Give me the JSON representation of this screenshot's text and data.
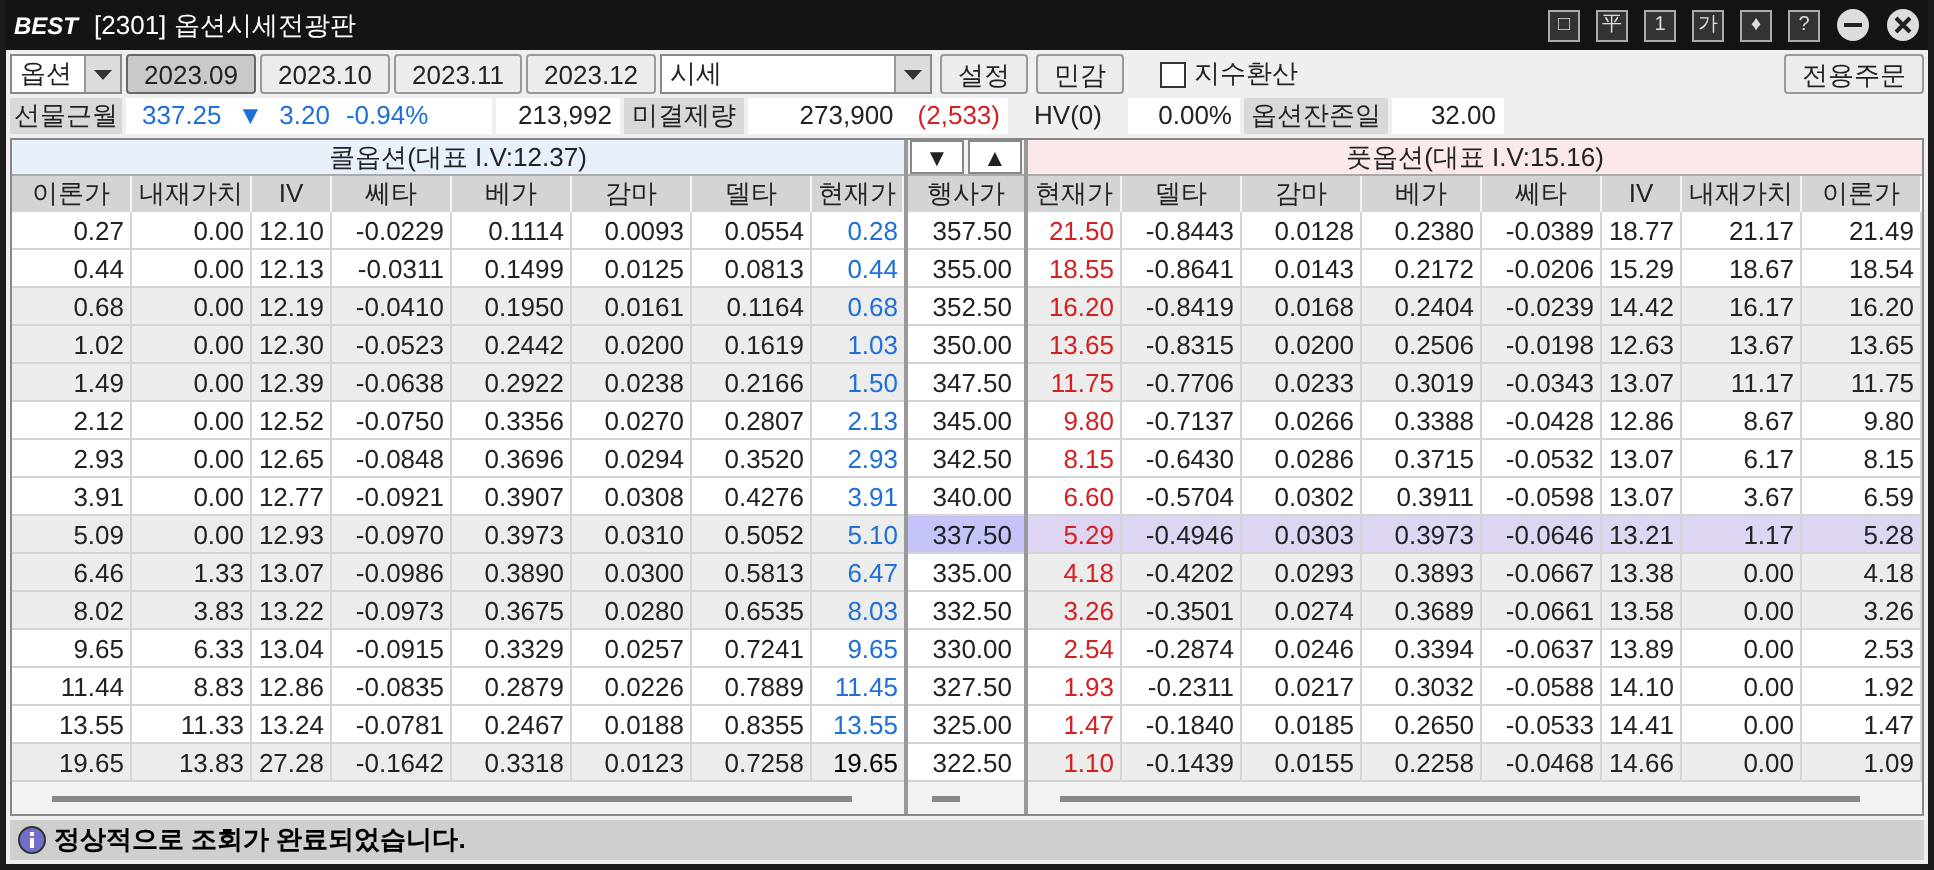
{
  "window": {
    "logo": "BEST",
    "title": "[2301] 옵션시세전광판",
    "tool_buttons": [
      "□",
      "平",
      "1",
      "가",
      "♦",
      "?"
    ]
  },
  "toolbar": {
    "product": "옵션",
    "months": [
      {
        "label": "2023.09",
        "selected": true
      },
      {
        "label": "2023.10",
        "selected": false
      },
      {
        "label": "2023.11",
        "selected": false
      },
      {
        "label": "2023.12",
        "selected": false
      }
    ],
    "view": "시세",
    "buttons": [
      "설정",
      "민감"
    ],
    "index_convert": {
      "label": "지수환산",
      "checked": false
    },
    "order_button": "전용주문"
  },
  "info": {
    "futures_label": "선물근월",
    "futures_price": "337.25",
    "futures_arrow": "▼",
    "futures_change": "3.20",
    "futures_rate": "-0.94%",
    "futures_volume": "213,992",
    "oi_label": "미결제량",
    "oi_value": "273,900",
    "oi_change": "(2,533)",
    "hv_label": "HV(0)",
    "hv_value": "0.00%",
    "days_label": "옵션잔존일",
    "days_value": "32.00"
  },
  "call_title": "콜옵션(대표 I.V:12.37)",
  "put_title": "풋옵션(대표 I.V:15.16)",
  "sort_buttons": [
    "▼",
    "▲"
  ],
  "call_columns": [
    "이론가",
    "내재가치",
    "IV",
    "쎄타",
    "베가",
    "감마",
    "델타",
    "현재가"
  ],
  "strike_column": "행사가",
  "put_columns": [
    "현재가",
    "델타",
    "감마",
    "베가",
    "쎄타",
    "IV",
    "내재가치",
    "이론가"
  ],
  "rows": [
    {
      "strike": "357.50",
      "shaded": false,
      "selected": false,
      "call": [
        "0.27",
        "0.00",
        "12.10",
        "-0.0229",
        "0.1114",
        "0.0093",
        "0.0554"
      ],
      "call_price": {
        "value": "0.28",
        "color": "#1e6fd9"
      },
      "put_price": {
        "value": "21.50",
        "color": "#d42020"
      },
      "put": [
        "-0.8443",
        "0.0128",
        "0.2380",
        "-0.0389",
        "18.77",
        "21.17",
        "21.49"
      ]
    },
    {
      "strike": "355.00",
      "shaded": false,
      "selected": false,
      "call": [
        "0.44",
        "0.00",
        "12.13",
        "-0.0311",
        "0.1499",
        "0.0125",
        "0.0813"
      ],
      "call_price": {
        "value": "0.44",
        "color": "#1e6fd9"
      },
      "put_price": {
        "value": "18.55",
        "color": "#d42020"
      },
      "put": [
        "-0.8641",
        "0.0143",
        "0.2172",
        "-0.0206",
        "15.29",
        "18.67",
        "18.54"
      ]
    },
    {
      "strike": "352.50",
      "shaded": true,
      "selected": false,
      "call": [
        "0.68",
        "0.00",
        "12.19",
        "-0.0410",
        "0.1950",
        "0.0161",
        "0.1164"
      ],
      "call_price": {
        "value": "0.68",
        "color": "#1e6fd9"
      },
      "put_price": {
        "value": "16.20",
        "color": "#d42020"
      },
      "put": [
        "-0.8419",
        "0.0168",
        "0.2404",
        "-0.0239",
        "14.42",
        "16.17",
        "16.20"
      ]
    },
    {
      "strike": "350.00",
      "shaded": true,
      "selected": false,
      "call": [
        "1.02",
        "0.00",
        "12.30",
        "-0.0523",
        "0.2442",
        "0.0200",
        "0.1619"
      ],
      "call_price": {
        "value": "1.03",
        "color": "#1e6fd9"
      },
      "put_price": {
        "value": "13.65",
        "color": "#d42020"
      },
      "put": [
        "-0.8315",
        "0.0200",
        "0.2506",
        "-0.0198",
        "12.63",
        "13.67",
        "13.65"
      ]
    },
    {
      "strike": "347.50",
      "shaded": true,
      "selected": false,
      "call": [
        "1.49",
        "0.00",
        "12.39",
        "-0.0638",
        "0.2922",
        "0.0238",
        "0.2166"
      ],
      "call_price": {
        "value": "1.50",
        "color": "#1e6fd9"
      },
      "put_price": {
        "value": "11.75",
        "color": "#d42020"
      },
      "put": [
        "-0.7706",
        "0.0233",
        "0.3019",
        "-0.0343",
        "13.07",
        "11.17",
        "11.75"
      ]
    },
    {
      "strike": "345.00",
      "shaded": false,
      "selected": false,
      "call": [
        "2.12",
        "0.00",
        "12.52",
        "-0.0750",
        "0.3356",
        "0.0270",
        "0.2807"
      ],
      "call_price": {
        "value": "2.13",
        "color": "#1e6fd9"
      },
      "put_price": {
        "value": "9.80",
        "color": "#d42020"
      },
      "put": [
        "-0.7137",
        "0.0266",
        "0.3388",
        "-0.0428",
        "12.86",
        "8.67",
        "9.80"
      ]
    },
    {
      "strike": "342.50",
      "shaded": false,
      "selected": false,
      "call": [
        "2.93",
        "0.00",
        "12.65",
        "-0.0848",
        "0.3696",
        "0.0294",
        "0.3520"
      ],
      "call_price": {
        "value": "2.93",
        "color": "#1e6fd9"
      },
      "put_price": {
        "value": "8.15",
        "color": "#d42020"
      },
      "put": [
        "-0.6430",
        "0.0286",
        "0.3715",
        "-0.0532",
        "13.07",
        "6.17",
        "8.15"
      ]
    },
    {
      "strike": "340.00",
      "shaded": false,
      "selected": false,
      "call": [
        "3.91",
        "0.00",
        "12.77",
        "-0.0921",
        "0.3907",
        "0.0308",
        "0.4276"
      ],
      "call_price": {
        "value": "3.91",
        "color": "#1e6fd9"
      },
      "put_price": {
        "value": "6.60",
        "color": "#d42020"
      },
      "put": [
        "-0.5704",
        "0.0302",
        "0.3911",
        "-0.0598",
        "13.07",
        "3.67",
        "6.59"
      ]
    },
    {
      "strike": "337.50",
      "shaded": true,
      "selected": true,
      "call": [
        "5.09",
        "0.00",
        "12.93",
        "-0.0970",
        "0.3973",
        "0.0310",
        "0.5052"
      ],
      "call_price": {
        "value": "5.10",
        "color": "#1e6fd9"
      },
      "put_price": {
        "value": "5.29",
        "color": "#d42020"
      },
      "put": [
        "-0.4946",
        "0.0303",
        "0.3973",
        "-0.0646",
        "13.21",
        "1.17",
        "5.28"
      ]
    },
    {
      "strike": "335.00",
      "shaded": true,
      "selected": false,
      "call": [
        "6.46",
        "1.33",
        "13.07",
        "-0.0986",
        "0.3890",
        "0.0300",
        "0.5813"
      ],
      "call_price": {
        "value": "6.47",
        "color": "#1e6fd9"
      },
      "put_price": {
        "value": "4.18",
        "color": "#d42020"
      },
      "put": [
        "-0.4202",
        "0.0293",
        "0.3893",
        "-0.0667",
        "13.38",
        "0.00",
        "4.18"
      ]
    },
    {
      "strike": "332.50",
      "shaded": true,
      "selected": false,
      "call": [
        "8.02",
        "3.83",
        "13.22",
        "-0.0973",
        "0.3675",
        "0.0280",
        "0.6535"
      ],
      "call_price": {
        "value": "8.03",
        "color": "#1e6fd9"
      },
      "put_price": {
        "value": "3.26",
        "color": "#d42020"
      },
      "put": [
        "-0.3501",
        "0.0274",
        "0.3689",
        "-0.0661",
        "13.58",
        "0.00",
        "3.26"
      ]
    },
    {
      "strike": "330.00",
      "shaded": false,
      "selected": false,
      "call": [
        "9.65",
        "6.33",
        "13.04",
        "-0.0915",
        "0.3329",
        "0.0257",
        "0.7241"
      ],
      "call_price": {
        "value": "9.65",
        "color": "#1e6fd9"
      },
      "put_price": {
        "value": "2.54",
        "color": "#d42020"
      },
      "put": [
        "-0.2874",
        "0.0246",
        "0.3394",
        "-0.0637",
        "13.89",
        "0.00",
        "2.53"
      ]
    },
    {
      "strike": "327.50",
      "shaded": false,
      "selected": false,
      "call": [
        "11.44",
        "8.83",
        "12.86",
        "-0.0835",
        "0.2879",
        "0.0226",
        "0.7889"
      ],
      "call_price": {
        "value": "11.45",
        "color": "#1e6fd9"
      },
      "put_price": {
        "value": "1.93",
        "color": "#d42020"
      },
      "put": [
        "-0.2311",
        "0.0217",
        "0.3032",
        "-0.0588",
        "14.10",
        "0.00",
        "1.92"
      ]
    },
    {
      "strike": "325.00",
      "shaded": false,
      "selected": false,
      "call": [
        "13.55",
        "11.33",
        "13.24",
        "-0.0781",
        "0.2467",
        "0.0188",
        "0.8355"
      ],
      "call_price": {
        "value": "13.55",
        "color": "#1e6fd9"
      },
      "put_price": {
        "value": "1.47",
        "color": "#d42020"
      },
      "put": [
        "-0.1840",
        "0.0185",
        "0.2650",
        "-0.0533",
        "14.41",
        "0.00",
        "1.47"
      ]
    },
    {
      "strike": "322.50",
      "shaded": true,
      "selected": false,
      "call": [
        "19.65",
        "13.83",
        "27.28",
        "-0.1642",
        "0.3318",
        "0.0123",
        "0.7258"
      ],
      "call_price": {
        "value": "19.65",
        "color": "#000000"
      },
      "put_price": {
        "value": "1.10",
        "color": "#d42020"
      },
      "put": [
        "-0.1439",
        "0.0155",
        "0.2258",
        "-0.0468",
        "14.66",
        "0.00",
        "1.09"
      ]
    }
  ],
  "status": "정상적으로 조회가 완료되었습니다."
}
